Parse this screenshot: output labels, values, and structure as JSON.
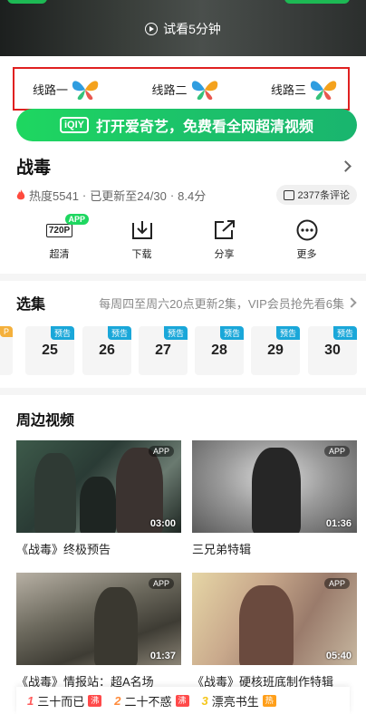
{
  "player": {
    "trial_text": "试看5分钟"
  },
  "lines": [
    {
      "label": "线路一"
    },
    {
      "label": "线路二"
    },
    {
      "label": "线路三"
    }
  ],
  "banner": {
    "logo": "iQIY",
    "text": "打开爱奇艺，免费看全网超清视频"
  },
  "show": {
    "title": "战毒",
    "heat": "热度5541",
    "update": "已更新至24/30",
    "rating": "8.4分",
    "comments": "2377条评论"
  },
  "actions": [
    {
      "label": "超清",
      "icon_text": "720P",
      "badge": "APP"
    },
    {
      "label": "下载"
    },
    {
      "label": "分享"
    },
    {
      "label": "更多"
    }
  ],
  "episodes": {
    "title": "选集",
    "note": "每周四至周六20点更新2集，VIP会员抢先看6集",
    "partial_badge": "P",
    "items": [
      {
        "num": "25",
        "badge": "预告"
      },
      {
        "num": "26",
        "badge": "预告"
      },
      {
        "num": "27",
        "badge": "预告"
      },
      {
        "num": "28",
        "badge": "预告"
      },
      {
        "num": "29",
        "badge": "预告"
      },
      {
        "num": "30",
        "badge": "预告"
      }
    ]
  },
  "related": {
    "title": "周边视频",
    "videos": [
      {
        "title": "《战毒》终极预告",
        "duration": "03:00",
        "badge": "APP"
      },
      {
        "title": "三兄弟特辑",
        "duration": "01:36",
        "badge": "APP"
      },
      {
        "title": "《战毒》情报站：超A名场",
        "duration": "01:37",
        "badge": "APP"
      },
      {
        "title": "《战毒》硬核班底制作特辑",
        "duration": "05:40",
        "badge": "APP"
      }
    ]
  },
  "hot": [
    {
      "rank": "1",
      "label": "三十而已",
      "tag": "沸",
      "rank_color": "#ff5a5a",
      "tag_color": "#ff4a4a"
    },
    {
      "rank": "2",
      "label": "二十不惑",
      "tag": "沸",
      "rank_color": "#ff8a3a",
      "tag_color": "#ff4a4a"
    },
    {
      "rank": "3",
      "label": "漂亮书生",
      "tag": "热",
      "rank_color": "#f5c518",
      "tag_color": "#ff9f1a"
    }
  ]
}
